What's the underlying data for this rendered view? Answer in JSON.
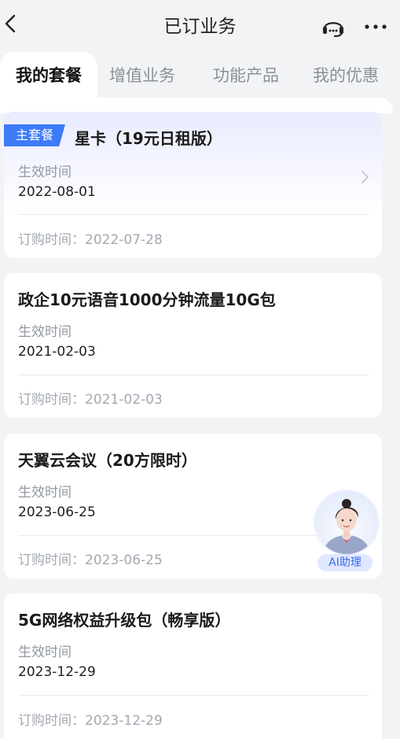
{
  "nav": {
    "title": "已订业务",
    "back_icon": "chevron-left-icon",
    "support_icon": "customer-service-icon",
    "more_icon": "more-dots-icon"
  },
  "tabs": [
    {
      "label": "我的套餐",
      "active": true
    },
    {
      "label": "增值业务",
      "active": false
    },
    {
      "label": "功能产品",
      "active": false
    },
    {
      "label": "我的优惠",
      "active": false
    }
  ],
  "packages": [
    {
      "badge": "主套餐",
      "title": "星卡（19元日租版）",
      "effective_label": "生效时间",
      "effective_date": "2022-08-01",
      "order_text": "订购时间：2022-07-28"
    },
    {
      "title": "政企10元语音1000分钟流量10G包",
      "effective_label": "生效时间",
      "effective_date": "2021-02-03",
      "order_text": "订购时间：2021-02-03"
    },
    {
      "title": "天翼云会议（20方限时）",
      "effective_label": "生效时间",
      "effective_date": "2023-06-25",
      "order_text": "订购时间：2023-06-25"
    },
    {
      "title": "5G网络权益升级包（畅享版）",
      "effective_label": "生效时间",
      "effective_date": "2023-12-29",
      "order_text": "订购时间：2023-12-29"
    }
  ],
  "ai_assistant": {
    "label": "AI助理"
  },
  "colors": {
    "accent": "#3d7bfb",
    "background": "#f2f3f5"
  }
}
